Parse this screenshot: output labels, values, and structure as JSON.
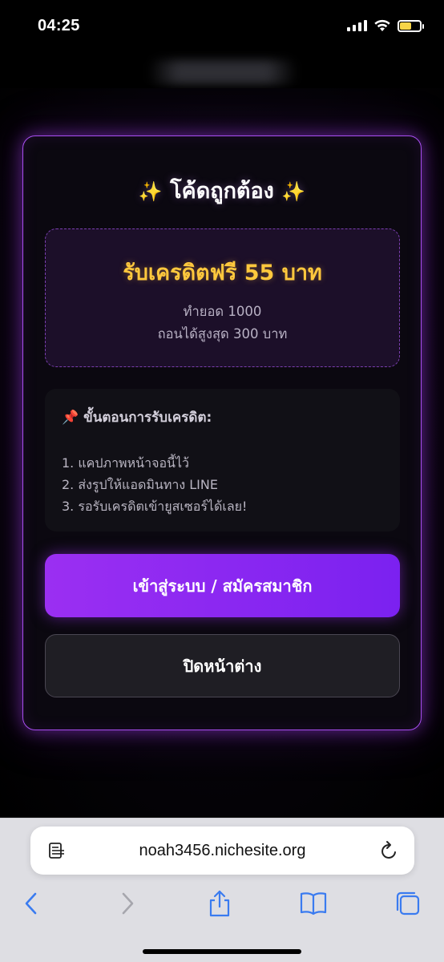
{
  "status_bar": {
    "time": "04:25",
    "battery_color": "#f7d547"
  },
  "modal": {
    "title": "โค้ดถูกต้อง",
    "sparkle_left": "✨",
    "sparkle_right": "✨",
    "promo": {
      "headline": "รับเครดิตฟรี 55 บาท",
      "line1": "ทำยอด 1000",
      "line2": "ถอนได้สูงสุด 300 บาท"
    },
    "steps": {
      "title": "📌 ขั้นตอนการรับเครดิต:",
      "items": [
        "1. แคปภาพหน้าจอนี้ไว้",
        "2. ส่งรูปให้แอดมินทาง LINE",
        "3. รอรับเครดิตเข้ายูสเซอร์ได้เลย!"
      ]
    },
    "primary_button": "เข้าสู่ระบบ / สมัครสมาชิก",
    "secondary_button": "ปิดหน้าต่าง",
    "accent_color": "#a84ef0",
    "headline_color": "#ffc83d"
  },
  "browser": {
    "url": "noah3456.nichesite.org",
    "icons": [
      "reader-mode-icon",
      "reload-icon",
      "back-icon",
      "forward-icon",
      "share-icon",
      "bookmarks-icon",
      "tabs-icon"
    ],
    "tint_color": "#3a7bf0"
  }
}
